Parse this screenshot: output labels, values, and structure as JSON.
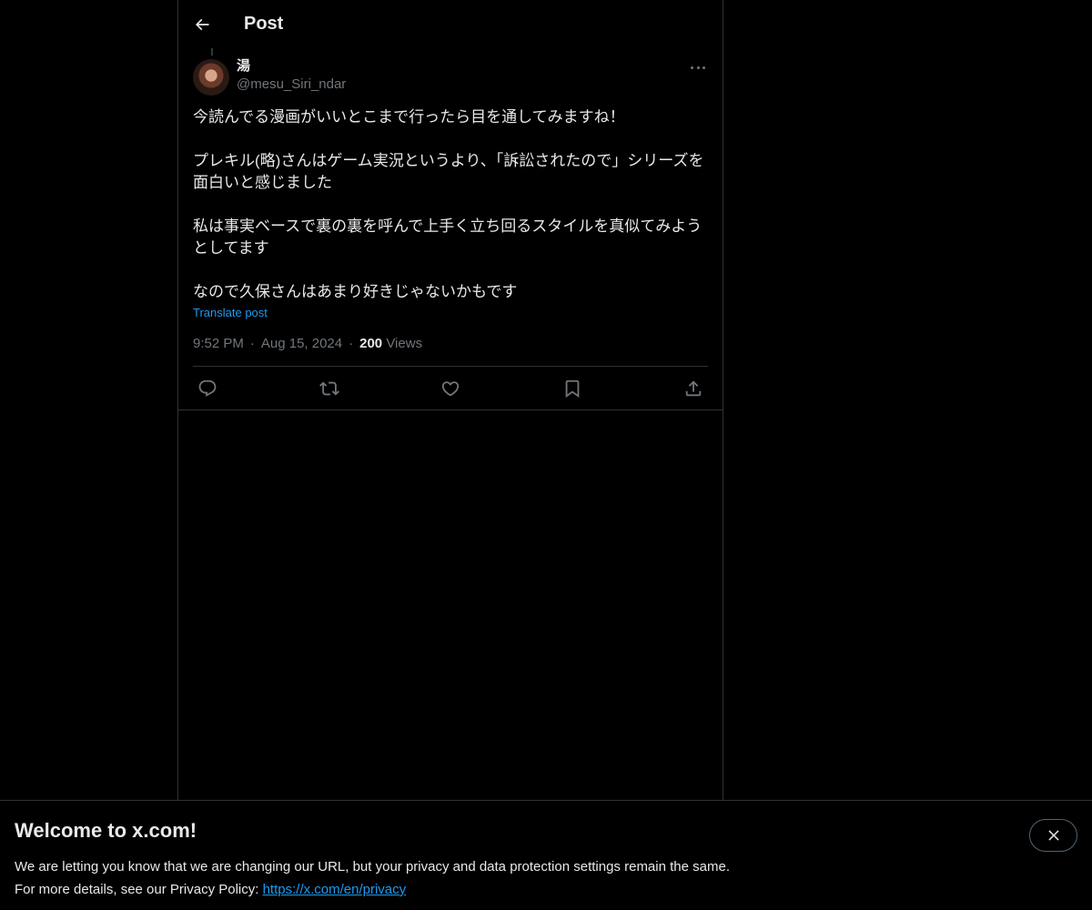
{
  "header": {
    "title": "Post",
    "back_icon": "arrow-left-icon"
  },
  "post": {
    "author": {
      "display_name": "湯",
      "handle": "@mesu_Siri_ndar"
    },
    "more_icon": "more-horizontal-icon",
    "text": "今読んでる漫画がいいとこまで行ったら目を通してみますね！\n\nプレキル(略)さんはゲーム実況というより、「訴訟されたので」シリーズを面白いと感じました\n\n私は事実ベースで裏の裏を呼んで上手く立ち回るスタイルを真似てみようとしてます\n\nなので久保さんはあまり好きじゃないかもです",
    "translate_label": "Translate post",
    "time": "9:52 PM",
    "date": "Aug 15, 2024",
    "separator": "·",
    "views_count": "200",
    "views_label": "Views",
    "actions": [
      "reply-icon",
      "repost-icon",
      "like-icon",
      "bookmark-icon",
      "share-icon"
    ]
  },
  "banner": {
    "title": "Welcome to x.com!",
    "line1": "We are letting you know that we are changing our URL, but your privacy and data protection settings remain the same.",
    "line2_prefix": "For more details, see our Privacy Policy: ",
    "link_text": "https://x.com/en/privacy",
    "close_icon": "close-icon"
  },
  "colors": {
    "background": "#000000",
    "text": "#e7e9ea",
    "muted": "#71767b",
    "accent": "#1d9bf0",
    "border": "#2f3336"
  }
}
